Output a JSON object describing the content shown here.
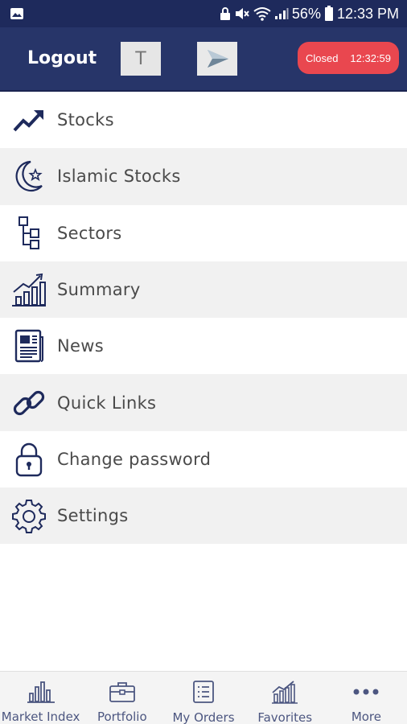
{
  "status_bar": {
    "battery": "56%",
    "time": "12:33 PM",
    "icons": [
      "image-icon",
      "lock-icon",
      "mute-icon",
      "wifi-icon",
      "signal-icon",
      "battery-icon"
    ]
  },
  "header": {
    "logout_label": "Logout",
    "t_button_label": "T",
    "market_status": "Closed",
    "market_time": "12:32:59",
    "colors": {
      "header_bg": "#273569",
      "status_badge": "#e9474f"
    }
  },
  "menu": {
    "items": [
      {
        "label": "Stocks",
        "icon": "trend-up-icon"
      },
      {
        "label": "Islamic Stocks",
        "icon": "crescent-star-icon"
      },
      {
        "label": "Sectors",
        "icon": "hierarchy-icon"
      },
      {
        "label": "Summary",
        "icon": "bar-growth-icon"
      },
      {
        "label": "News",
        "icon": "newspaper-icon"
      },
      {
        "label": "Quick Links",
        "icon": "link-icon"
      },
      {
        "label": "Change password",
        "icon": "lock-icon"
      },
      {
        "label": "Settings",
        "icon": "gear-icon"
      }
    ]
  },
  "bottom_nav": {
    "items": [
      {
        "label": "Market Index",
        "icon": "bar-chart-icon"
      },
      {
        "label": "Portfolio",
        "icon": "briefcase-icon"
      },
      {
        "label": "My Orders",
        "icon": "list-icon"
      },
      {
        "label": "Favorites",
        "icon": "chart-trend-icon"
      },
      {
        "label": "More",
        "icon": "more-dots-icon"
      }
    ]
  }
}
